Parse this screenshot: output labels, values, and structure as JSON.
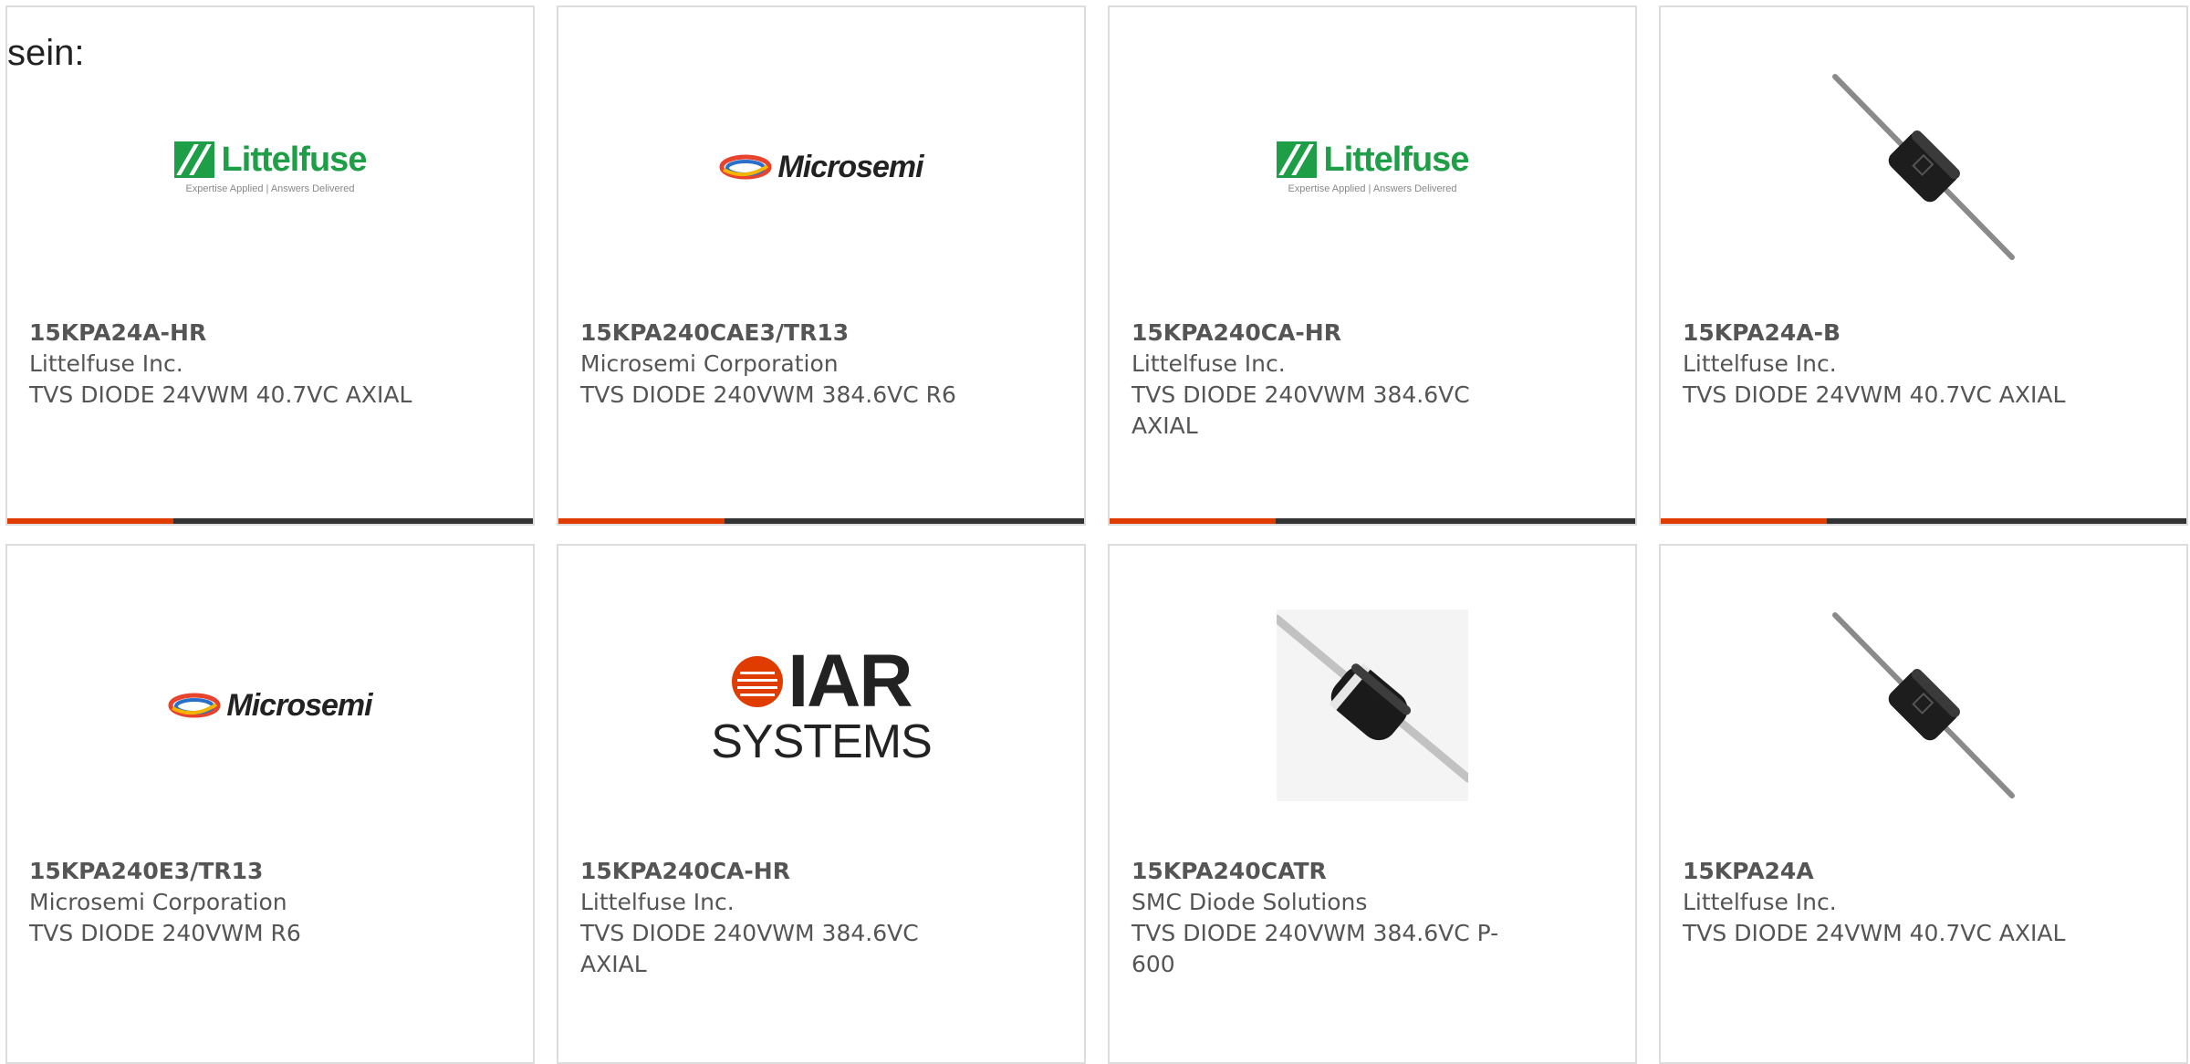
{
  "page": {
    "heading": "sein:"
  },
  "logos": {
    "littelfuse": {
      "name": "Littelfuse",
      "tagline": "Expertise Applied | Answers Delivered",
      "color": "#1e9e47"
    },
    "microsemi": {
      "name": "Microsemi"
    },
    "iar": {
      "top": "IAR",
      "bottom": "SYSTEMS",
      "color": "#e03c00"
    }
  },
  "colors": {
    "accent_bar": "#e03c00",
    "bar": "#333333",
    "card_border": "#dddddd",
    "text": "#555555"
  },
  "products": [
    {
      "part_number": "15KPA24A-HR",
      "manufacturer": "Littelfuse Inc.",
      "description": "TVS DIODE 24VWM 40.7VC AXIAL",
      "image": "littelfuse-logo"
    },
    {
      "part_number": "15KPA240CAE3/TR13",
      "manufacturer": "Microsemi Corporation",
      "description": "TVS DIODE 240VWM 384.6VC R6",
      "image": "microsemi-logo"
    },
    {
      "part_number": "15KPA240CA-HR",
      "manufacturer": "Littelfuse Inc.",
      "description": "TVS DIODE 240VWM 384.6VC AXIAL",
      "image": "littelfuse-logo"
    },
    {
      "part_number": "15KPA24A-B",
      "manufacturer": "Littelfuse Inc.",
      "description": "TVS DIODE 24VWM 40.7VC AXIAL",
      "image": "axial-diode-photo"
    },
    {
      "part_number": "15KPA240E3/TR13",
      "manufacturer": "Microsemi Corporation",
      "description": "TVS DIODE 240VWM R6",
      "image": "microsemi-logo"
    },
    {
      "part_number": "15KPA240CA-HR",
      "manufacturer": "Littelfuse Inc.",
      "description": "TVS DIODE 240VWM 384.6VC AXIAL",
      "image": "iar-systems-logo"
    },
    {
      "part_number": "15KPA240CATR",
      "manufacturer": "SMC Diode Solutions",
      "description": "TVS DIODE 240VWM 384.6VC P-600",
      "image": "axial-diode-photo-silver"
    },
    {
      "part_number": "15KPA24A",
      "manufacturer": "Littelfuse Inc.",
      "description": "TVS DIODE 24VWM 40.7VC AXIAL",
      "image": "axial-diode-photo"
    }
  ]
}
